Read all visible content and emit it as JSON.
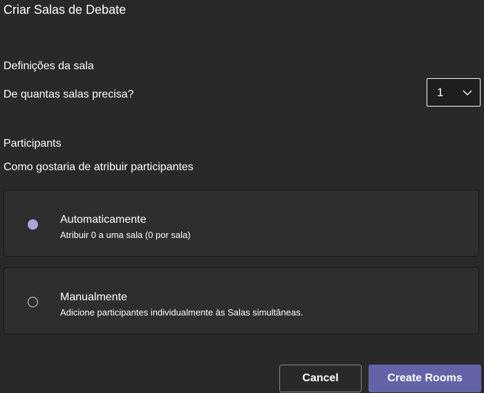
{
  "dialog": {
    "title": "Criar Salas de Debate"
  },
  "room_settings": {
    "heading": "Definições da sala",
    "question": "De quantas salas precisa?",
    "count_value": "1"
  },
  "participants": {
    "heading": "Participants",
    "question": "Como gostaria de atribuir participantes",
    "options": [
      {
        "title": "Automaticamente",
        "description": "Atribuir 0 a uma sala (0 por sala)",
        "selected": true
      },
      {
        "title": "Manualmente",
        "description": "Adicione participantes individualmente às Salas simultâneas.",
        "selected": false
      }
    ]
  },
  "buttons": {
    "cancel": "Cancel",
    "create": "Create Rooms"
  },
  "colors": {
    "background": "#292929",
    "card_background": "#2e2e2e",
    "accent": "#6264a7",
    "radio_selected": "#a6a7dc"
  }
}
